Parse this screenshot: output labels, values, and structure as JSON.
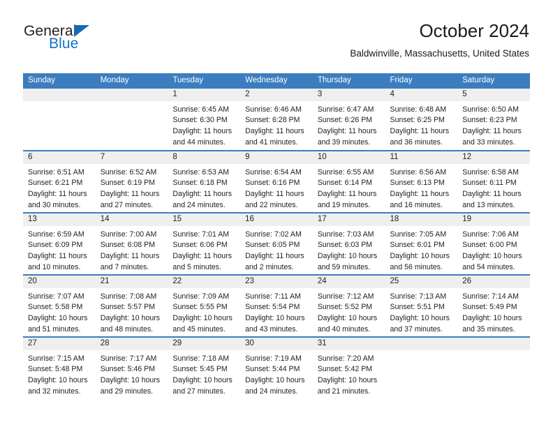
{
  "logo": {
    "line1": "General",
    "line2": "Blue",
    "triangle_color": "#1668b3",
    "line2_color": "#1473c4"
  },
  "header": {
    "title": "October 2024",
    "subtitle": "Baldwinville, Massachusetts, United States"
  },
  "theme": {
    "header_blue": "#3b7dbf",
    "daynum_bg": "#efefef",
    "text": "#222222"
  },
  "calendar": {
    "weekdays": [
      "Sunday",
      "Monday",
      "Tuesday",
      "Wednesday",
      "Thursday",
      "Friday",
      "Saturday"
    ],
    "weeks": [
      [
        {
          "day": ""
        },
        {
          "day": ""
        },
        {
          "day": "1",
          "sunrise": "Sunrise: 6:45 AM",
          "sunset": "Sunset: 6:30 PM",
          "daylight_1": "Daylight: 11 hours",
          "daylight_2": "and 44 minutes."
        },
        {
          "day": "2",
          "sunrise": "Sunrise: 6:46 AM",
          "sunset": "Sunset: 6:28 PM",
          "daylight_1": "Daylight: 11 hours",
          "daylight_2": "and 41 minutes."
        },
        {
          "day": "3",
          "sunrise": "Sunrise: 6:47 AM",
          "sunset": "Sunset: 6:26 PM",
          "daylight_1": "Daylight: 11 hours",
          "daylight_2": "and 39 minutes."
        },
        {
          "day": "4",
          "sunrise": "Sunrise: 6:48 AM",
          "sunset": "Sunset: 6:25 PM",
          "daylight_1": "Daylight: 11 hours",
          "daylight_2": "and 36 minutes."
        },
        {
          "day": "5",
          "sunrise": "Sunrise: 6:50 AM",
          "sunset": "Sunset: 6:23 PM",
          "daylight_1": "Daylight: 11 hours",
          "daylight_2": "and 33 minutes."
        }
      ],
      [
        {
          "day": "6",
          "sunrise": "Sunrise: 6:51 AM",
          "sunset": "Sunset: 6:21 PM",
          "daylight_1": "Daylight: 11 hours",
          "daylight_2": "and 30 minutes."
        },
        {
          "day": "7",
          "sunrise": "Sunrise: 6:52 AM",
          "sunset": "Sunset: 6:19 PM",
          "daylight_1": "Daylight: 11 hours",
          "daylight_2": "and 27 minutes."
        },
        {
          "day": "8",
          "sunrise": "Sunrise: 6:53 AM",
          "sunset": "Sunset: 6:18 PM",
          "daylight_1": "Daylight: 11 hours",
          "daylight_2": "and 24 minutes."
        },
        {
          "day": "9",
          "sunrise": "Sunrise: 6:54 AM",
          "sunset": "Sunset: 6:16 PM",
          "daylight_1": "Daylight: 11 hours",
          "daylight_2": "and 22 minutes."
        },
        {
          "day": "10",
          "sunrise": "Sunrise: 6:55 AM",
          "sunset": "Sunset: 6:14 PM",
          "daylight_1": "Daylight: 11 hours",
          "daylight_2": "and 19 minutes."
        },
        {
          "day": "11",
          "sunrise": "Sunrise: 6:56 AM",
          "sunset": "Sunset: 6:13 PM",
          "daylight_1": "Daylight: 11 hours",
          "daylight_2": "and 16 minutes."
        },
        {
          "day": "12",
          "sunrise": "Sunrise: 6:58 AM",
          "sunset": "Sunset: 6:11 PM",
          "daylight_1": "Daylight: 11 hours",
          "daylight_2": "and 13 minutes."
        }
      ],
      [
        {
          "day": "13",
          "sunrise": "Sunrise: 6:59 AM",
          "sunset": "Sunset: 6:09 PM",
          "daylight_1": "Daylight: 11 hours",
          "daylight_2": "and 10 minutes."
        },
        {
          "day": "14",
          "sunrise": "Sunrise: 7:00 AM",
          "sunset": "Sunset: 6:08 PM",
          "daylight_1": "Daylight: 11 hours",
          "daylight_2": "and 7 minutes."
        },
        {
          "day": "15",
          "sunrise": "Sunrise: 7:01 AM",
          "sunset": "Sunset: 6:06 PM",
          "daylight_1": "Daylight: 11 hours",
          "daylight_2": "and 5 minutes."
        },
        {
          "day": "16",
          "sunrise": "Sunrise: 7:02 AM",
          "sunset": "Sunset: 6:05 PM",
          "daylight_1": "Daylight: 11 hours",
          "daylight_2": "and 2 minutes."
        },
        {
          "day": "17",
          "sunrise": "Sunrise: 7:03 AM",
          "sunset": "Sunset: 6:03 PM",
          "daylight_1": "Daylight: 10 hours",
          "daylight_2": "and 59 minutes."
        },
        {
          "day": "18",
          "sunrise": "Sunrise: 7:05 AM",
          "sunset": "Sunset: 6:01 PM",
          "daylight_1": "Daylight: 10 hours",
          "daylight_2": "and 56 minutes."
        },
        {
          "day": "19",
          "sunrise": "Sunrise: 7:06 AM",
          "sunset": "Sunset: 6:00 PM",
          "daylight_1": "Daylight: 10 hours",
          "daylight_2": "and 54 minutes."
        }
      ],
      [
        {
          "day": "20",
          "sunrise": "Sunrise: 7:07 AM",
          "sunset": "Sunset: 5:58 PM",
          "daylight_1": "Daylight: 10 hours",
          "daylight_2": "and 51 minutes."
        },
        {
          "day": "21",
          "sunrise": "Sunrise: 7:08 AM",
          "sunset": "Sunset: 5:57 PM",
          "daylight_1": "Daylight: 10 hours",
          "daylight_2": "and 48 minutes."
        },
        {
          "day": "22",
          "sunrise": "Sunrise: 7:09 AM",
          "sunset": "Sunset: 5:55 PM",
          "daylight_1": "Daylight: 10 hours",
          "daylight_2": "and 45 minutes."
        },
        {
          "day": "23",
          "sunrise": "Sunrise: 7:11 AM",
          "sunset": "Sunset: 5:54 PM",
          "daylight_1": "Daylight: 10 hours",
          "daylight_2": "and 43 minutes."
        },
        {
          "day": "24",
          "sunrise": "Sunrise: 7:12 AM",
          "sunset": "Sunset: 5:52 PM",
          "daylight_1": "Daylight: 10 hours",
          "daylight_2": "and 40 minutes."
        },
        {
          "day": "25",
          "sunrise": "Sunrise: 7:13 AM",
          "sunset": "Sunset: 5:51 PM",
          "daylight_1": "Daylight: 10 hours",
          "daylight_2": "and 37 minutes."
        },
        {
          "day": "26",
          "sunrise": "Sunrise: 7:14 AM",
          "sunset": "Sunset: 5:49 PM",
          "daylight_1": "Daylight: 10 hours",
          "daylight_2": "and 35 minutes."
        }
      ],
      [
        {
          "day": "27",
          "sunrise": "Sunrise: 7:15 AM",
          "sunset": "Sunset: 5:48 PM",
          "daylight_1": "Daylight: 10 hours",
          "daylight_2": "and 32 minutes."
        },
        {
          "day": "28",
          "sunrise": "Sunrise: 7:17 AM",
          "sunset": "Sunset: 5:46 PM",
          "daylight_1": "Daylight: 10 hours",
          "daylight_2": "and 29 minutes."
        },
        {
          "day": "29",
          "sunrise": "Sunrise: 7:18 AM",
          "sunset": "Sunset: 5:45 PM",
          "daylight_1": "Daylight: 10 hours",
          "daylight_2": "and 27 minutes."
        },
        {
          "day": "30",
          "sunrise": "Sunrise: 7:19 AM",
          "sunset": "Sunset: 5:44 PM",
          "daylight_1": "Daylight: 10 hours",
          "daylight_2": "and 24 minutes."
        },
        {
          "day": "31",
          "sunrise": "Sunrise: 7:20 AM",
          "sunset": "Sunset: 5:42 PM",
          "daylight_1": "Daylight: 10 hours",
          "daylight_2": "and 21 minutes."
        },
        {
          "day": ""
        },
        {
          "day": ""
        }
      ]
    ]
  }
}
